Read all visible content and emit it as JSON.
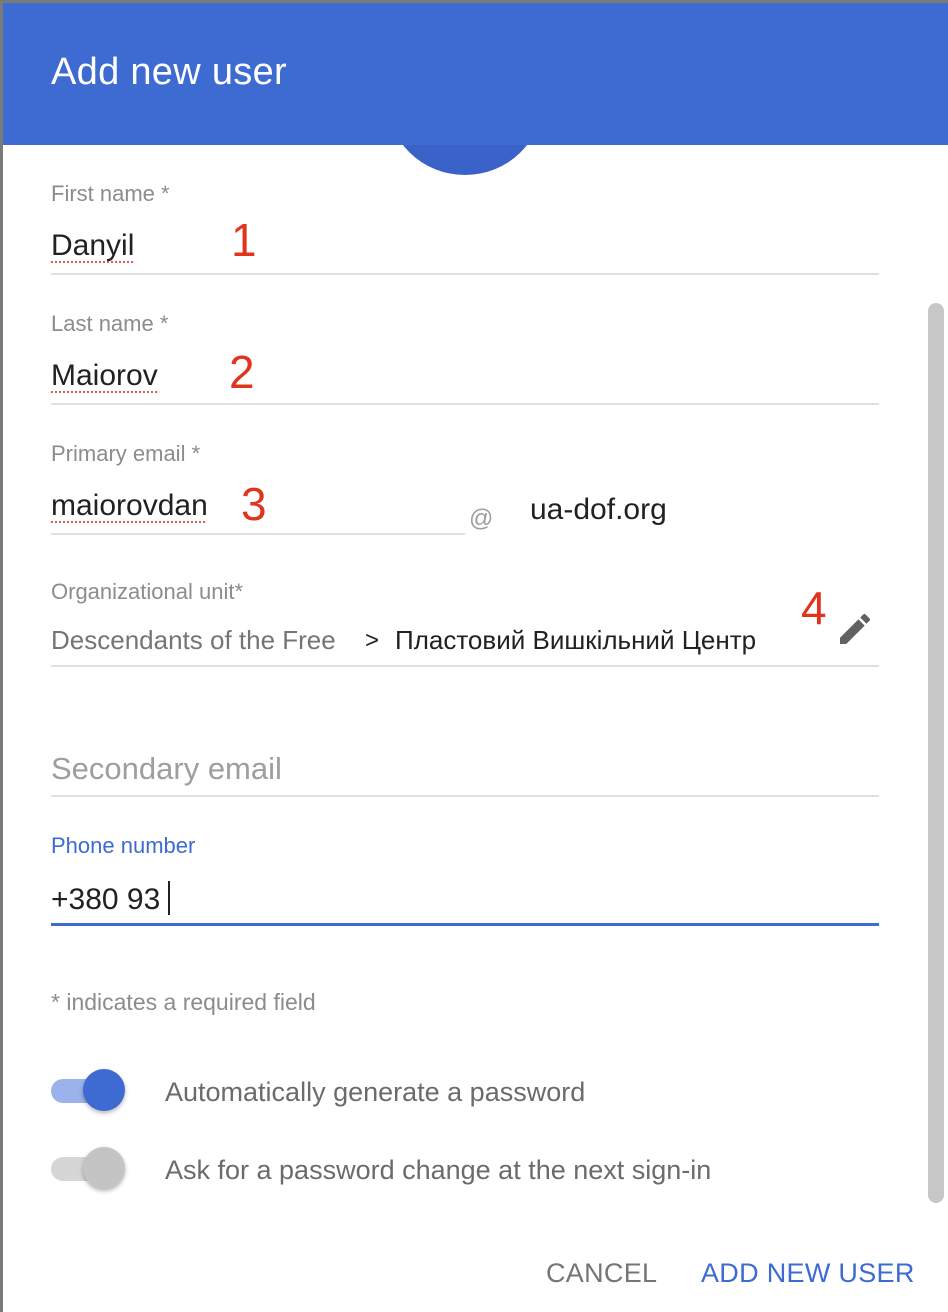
{
  "dialog": {
    "title": "Add new user"
  },
  "form": {
    "first_name": {
      "label": "First name *",
      "value": "Danyil",
      "annotation": "1"
    },
    "last_name": {
      "label": "Last name *",
      "value": "Maiorov",
      "annotation": "2"
    },
    "primary_email": {
      "label": "Primary email *",
      "value": "maiorovdan",
      "at": "@",
      "domain": "ua-dof.org",
      "annotation": "3"
    },
    "org_unit": {
      "label": "Organizational unit*",
      "parent": "Descendants of the Free",
      "separator": ">",
      "child": "Пластовий Вишкільний Центр",
      "annotation": "4",
      "edit_icon": "pencil-icon"
    },
    "secondary_email": {
      "placeholder": "Secondary email"
    },
    "phone": {
      "label": "Phone number",
      "value": "+380 93"
    },
    "required_note": "* indicates a required field"
  },
  "toggles": [
    {
      "label": "Automatically generate a password",
      "on": true
    },
    {
      "label": "Ask for a password change at the next sign-in",
      "on": false
    }
  ],
  "actions": {
    "cancel": "CANCEL",
    "submit": "ADD NEW USER"
  },
  "colors": {
    "accent": "#3d6bd2",
    "annotation": "#e0341e"
  }
}
